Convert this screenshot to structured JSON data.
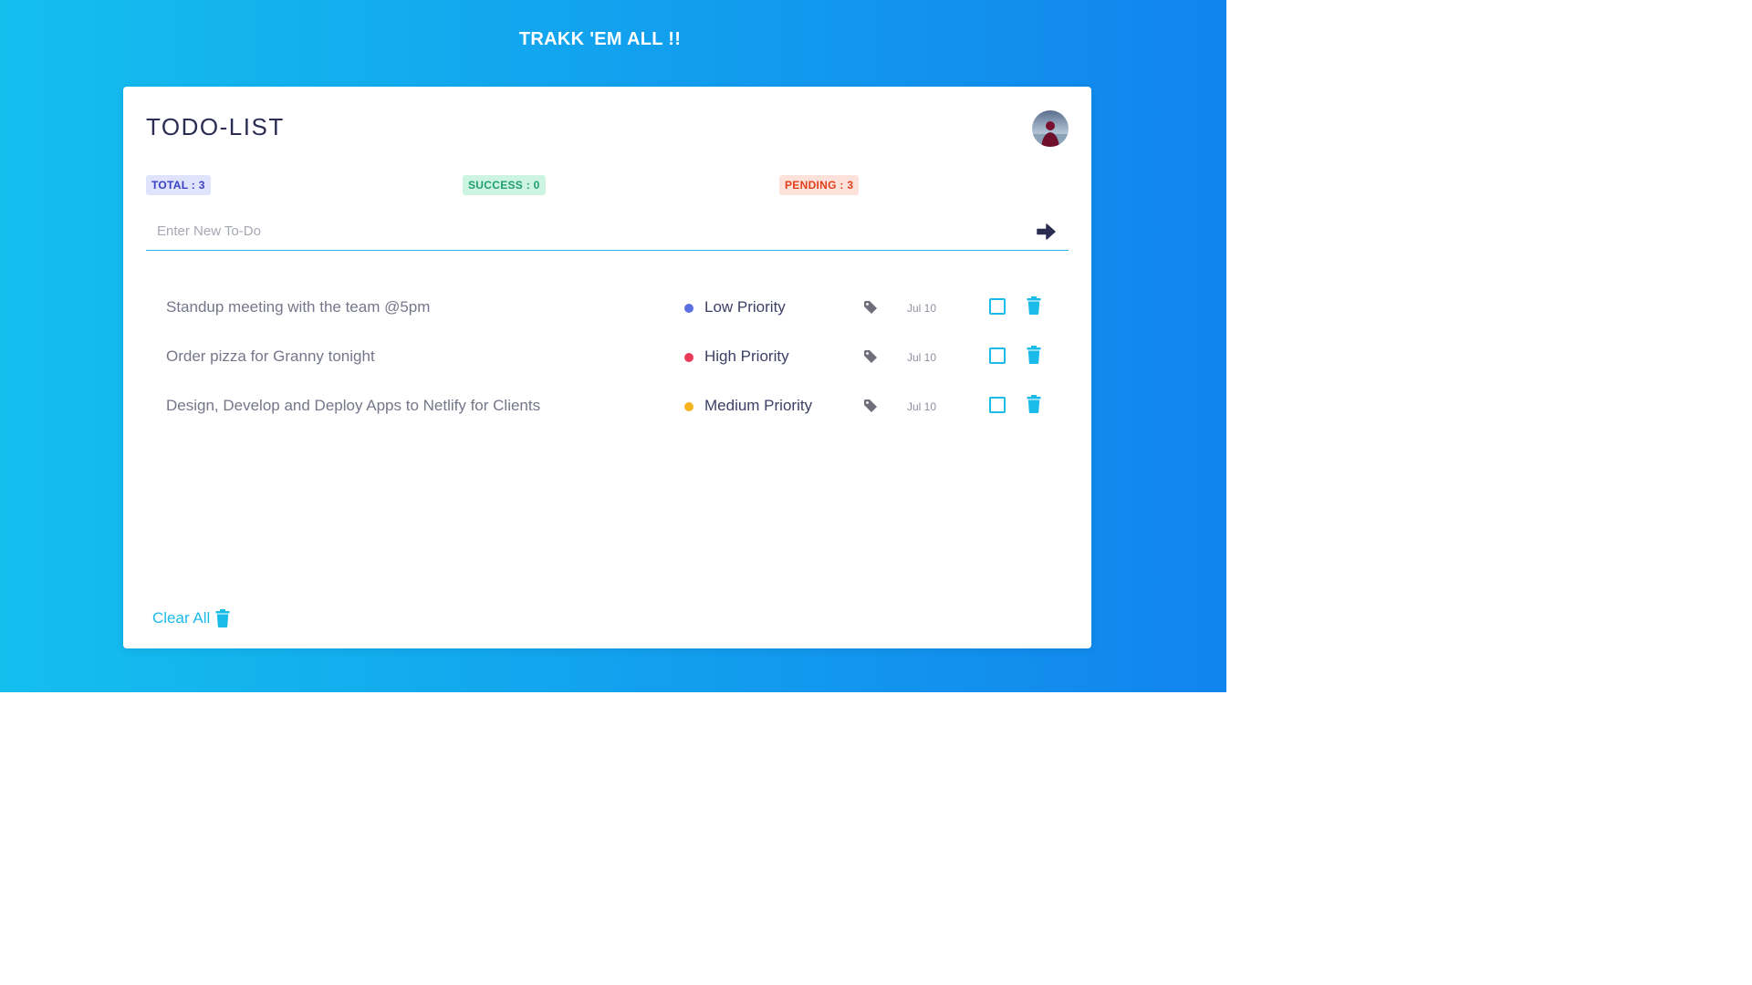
{
  "app": {
    "title": "TRAKK 'EM ALL !!"
  },
  "card": {
    "title": "TODO-LIST"
  },
  "stats": {
    "total": "TOTAL : 3",
    "success": "SUCCESS : 0",
    "pending": "PENDING : 3"
  },
  "input": {
    "placeholder": "Enter New To-Do",
    "value": ""
  },
  "todos": [
    {
      "text": "Standup meeting with the team @5pm",
      "priority": "Low Priority",
      "priority_color": "#5a6fe0",
      "date": "Jul 10",
      "done": false
    },
    {
      "text": "Order pizza for Granny tonight",
      "priority": "High Priority",
      "priority_color": "#ea3a5a",
      "date": "Jul 10",
      "done": false
    },
    {
      "text": "Design, Develop and Deploy Apps to Netlify for Clients",
      "priority": "Medium Priority",
      "priority_color": "#f5b320",
      "date": "Jul 10",
      "done": false
    }
  ],
  "footer": {
    "clear_all": "Clear All"
  },
  "colors": {
    "accent": "#1bbbe9",
    "gradient_start": "#14bfee",
    "gradient_end": "#1184ee",
    "title_dark": "#2b2d52"
  },
  "icons": {
    "submit": "arrow-right-icon",
    "tag": "tag-icon",
    "check": "checkbox-icon",
    "delete": "trash-icon",
    "avatar": "avatar"
  }
}
